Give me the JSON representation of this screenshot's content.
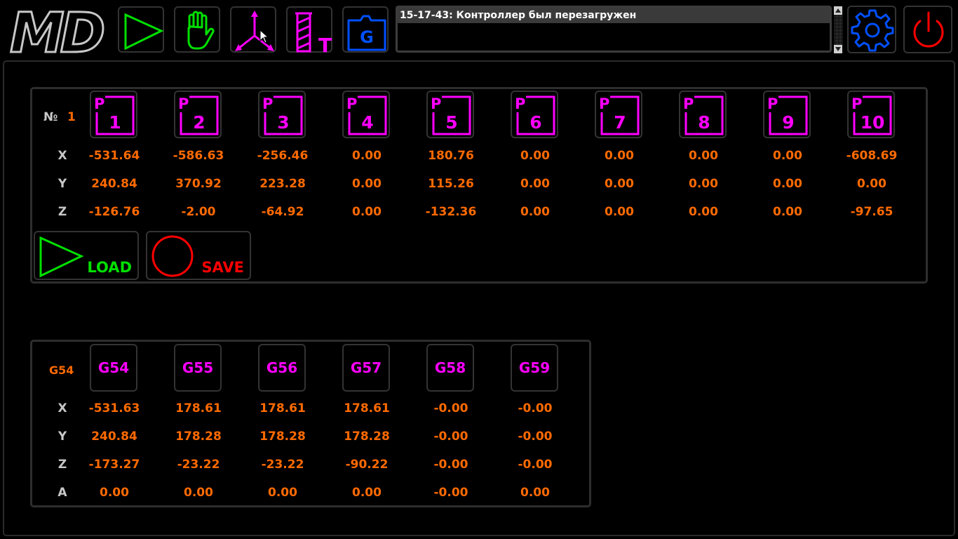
{
  "app": {
    "logo_text": "MD"
  },
  "toolbar": {
    "buttons": [
      {
        "name": "run-button",
        "icon": "play-icon",
        "color": "#00e000"
      },
      {
        "name": "manual-button",
        "icon": "hand-icon",
        "color": "#00e000"
      },
      {
        "name": "coordinates-button",
        "icon": "axes-icon",
        "color": "#ff00ff"
      },
      {
        "name": "tool-button",
        "icon": "tool-icon",
        "color": "#ff00ff",
        "label": "T"
      },
      {
        "name": "gcode-folder-button",
        "icon": "folder-icon",
        "color": "#0050ff",
        "label": "G"
      },
      {
        "name": "settings-button",
        "icon": "gear-icon",
        "color": "#0050ff"
      },
      {
        "name": "power-button",
        "icon": "power-icon",
        "color": "#ff0000"
      }
    ]
  },
  "log": {
    "message": "15-17-43: Контроллер был перезагружен"
  },
  "points_panel": {
    "number_label": "№",
    "selected": "1",
    "points": [
      {
        "label": "P",
        "num": "1",
        "x": "-531.64",
        "y": "240.84",
        "z": "-126.76"
      },
      {
        "label": "P",
        "num": "2",
        "x": "-586.63",
        "y": "370.92",
        "z": "-2.00"
      },
      {
        "label": "P",
        "num": "3",
        "x": "-256.46",
        "y": "223.28",
        "z": "-64.92"
      },
      {
        "label": "P",
        "num": "4",
        "x": "0.00",
        "y": "0.00",
        "z": "0.00"
      },
      {
        "label": "P",
        "num": "5",
        "x": "180.76",
        "y": "115.26",
        "z": "-132.36"
      },
      {
        "label": "P",
        "num": "6",
        "x": "0.00",
        "y": "0.00",
        "z": "0.00"
      },
      {
        "label": "P",
        "num": "7",
        "x": "0.00",
        "y": "0.00",
        "z": "0.00"
      },
      {
        "label": "P",
        "num": "8",
        "x": "0.00",
        "y": "0.00",
        "z": "0.00"
      },
      {
        "label": "P",
        "num": "9",
        "x": "0.00",
        "y": "0.00",
        "z": "0.00"
      },
      {
        "label": "P",
        "num": "10",
        "x": "-608.69",
        "y": "0.00",
        "z": "-97.65"
      }
    ],
    "axes": [
      "X",
      "Y",
      "Z"
    ],
    "load_label": "LOAD",
    "save_label": "SAVE",
    "load_color": "#00e000",
    "save_color": "#ff0000"
  },
  "offsets_panel": {
    "selected": "G54",
    "axes": [
      "X",
      "Y",
      "Z",
      "A"
    ],
    "offsets": [
      {
        "label": "G54",
        "x": "-531.63",
        "y": "240.84",
        "z": "-173.27",
        "a": "0.00"
      },
      {
        "label": "G55",
        "x": "178.61",
        "y": "178.28",
        "z": "-23.22",
        "a": "0.00"
      },
      {
        "label": "G56",
        "x": "178.61",
        "y": "178.28",
        "z": "-23.22",
        "a": "0.00"
      },
      {
        "label": "G57",
        "x": "178.61",
        "y": "178.28",
        "z": "-90.22",
        "a": "0.00"
      },
      {
        "label": "G58",
        "x": "-0.00",
        "y": "-0.00",
        "z": "-0.00",
        "a": "-0.00"
      },
      {
        "label": "G59",
        "x": "-0.00",
        "y": "-0.00",
        "z": "-0.00",
        "a": "0.00"
      }
    ]
  },
  "colors": {
    "accent": "#ff00ff",
    "value": "#ff6a00",
    "green": "#00e000",
    "blue": "#0050ff",
    "red": "#ff0000"
  }
}
